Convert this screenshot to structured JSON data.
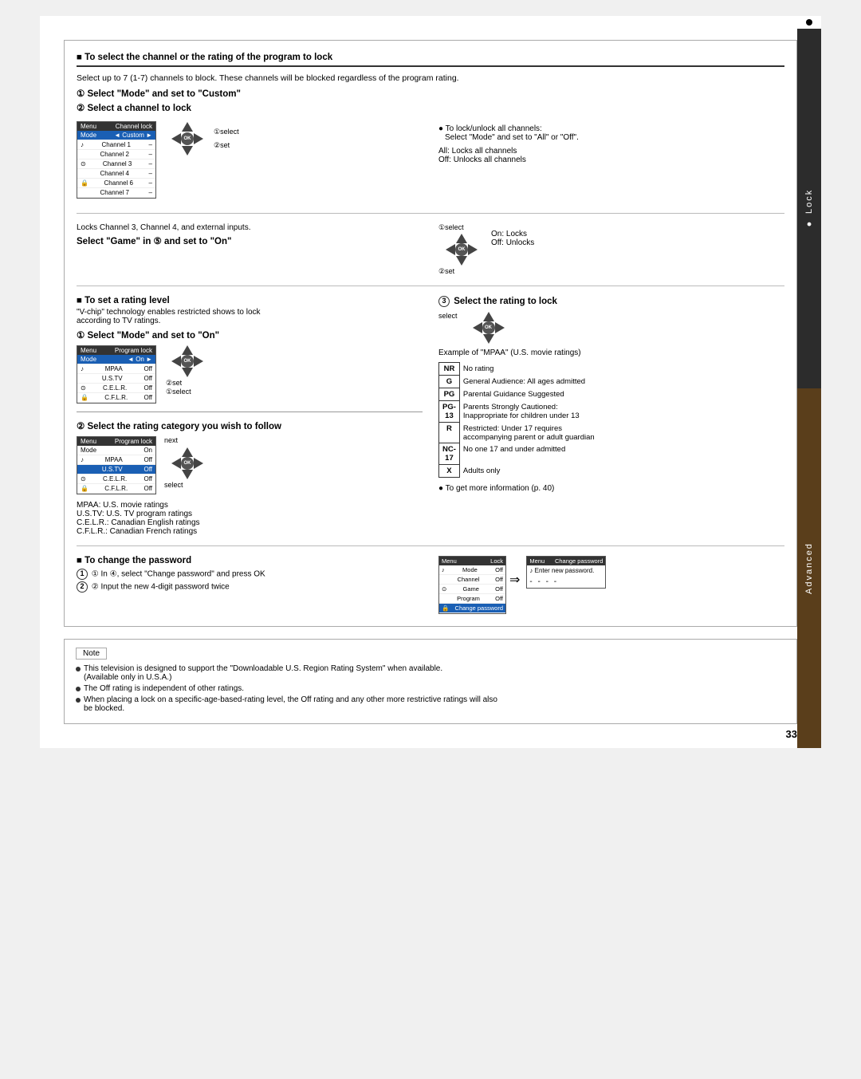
{
  "page": {
    "number": "33",
    "header": {
      "section_marker": "■",
      "title": "To select the channel or the rating of the program to lock"
    },
    "intro": "Select up to 7 (1-7) channels to block. These channels will be blocked regardless of the program rating.",
    "step1_title": "① Select \"Mode\" and set to \"Custom\"",
    "step2_title": "② Select a channel to lock",
    "right_info_1": "● To lock/unlock all channels:",
    "right_info_2": "Select \"Mode\" and set to \"All\" or \"Off\".",
    "right_info_3": "All:  Locks all channels",
    "right_info_4": "Off:  Unlocks all channels",
    "channel_lock_menu": {
      "title": "Channel lock",
      "col1": "Mode",
      "col2": "◄ Custom ►",
      "rows": [
        {
          "icon": "♪",
          "label": "Channel 1",
          "value": "–"
        },
        {
          "icon": "",
          "label": "Channel 2",
          "value": "–"
        },
        {
          "icon": "⊙",
          "label": "Channel 3",
          "value": "–"
        },
        {
          "icon": "",
          "label": "Channel 4",
          "value": "–"
        },
        {
          "icon": "🔒",
          "label": "Channel 6",
          "value": "–"
        },
        {
          "icon": "",
          "label": "Channel 7",
          "value": "–"
        }
      ]
    },
    "select_label_1": "①select",
    "set_label_1": "②set",
    "game_section": {
      "text": "Locks Channel 3, Channel 4, and external inputs.",
      "title": "Select \"Game\" in ⑤ and set to \"On\"",
      "on_locks": "On:  Locks",
      "off_unlocks": "Off:  Unlocks",
      "select_label": "①select",
      "set_label": "②set"
    },
    "rating_section": {
      "marker": "■",
      "title": "To set a rating level",
      "desc1": "\"V-chip\" technology enables restricted shows to lock",
      "desc2": "according to TV ratings.",
      "step1": "① Select \"Mode\" and set to \"On\"",
      "step2": "② Select the rating category you wish to follow",
      "step2_note": "next",
      "step2_select": "select",
      "mpaa_note": "MPAA:   U.S. movie ratings",
      "ustv_note": "U.S.TV:  U.S. TV program ratings",
      "celr_note": "C.E.L.R.: Canadian English ratings",
      "cflr_note": "C.F.L.R.: Canadian French ratings",
      "program_lock_menu": {
        "title": "Program lock",
        "col1": "Mode",
        "col2": "On",
        "rows": [
          {
            "label": "MPAA",
            "value": "Off"
          },
          {
            "label": "U.S.TV",
            "value": "Off"
          },
          {
            "label": "C.E.L.R.",
            "value": "Off"
          },
          {
            "label": "C.F.L.R.",
            "value": "Off"
          }
        ]
      },
      "set_label": "②set",
      "select_label": "①select",
      "program_lock_menu2": {
        "title": "Program lock",
        "col1": "Mode",
        "col2": "On",
        "rows": [
          {
            "label": "MPAA",
            "value": "Off",
            "highlighted": false
          },
          {
            "label": "U.S.TV",
            "value": "Off",
            "highlighted": true
          },
          {
            "label": "C.E.L.R.",
            "value": "Off",
            "highlighted": false
          },
          {
            "label": "C.F.L.R.",
            "value": "Off",
            "highlighted": false
          }
        ]
      }
    },
    "select_rating": {
      "marker": "③",
      "title": "Select the rating to lock",
      "select_label": "select",
      "example": "Example of \"MPAA\" (U.S. movie ratings)",
      "ratings": [
        {
          "code": "NR",
          "desc": "No rating"
        },
        {
          "code": "G",
          "desc": "General Audience: All ages admitted"
        },
        {
          "code": "PG",
          "desc": "Parental Guidance Suggested"
        },
        {
          "code": "PG-\n13",
          "desc": "Parents Strongly Cautioned:\nInappropriate for children under 13"
        },
        {
          "code": "R",
          "desc": "Restricted: Under 17 requires\naccompanying parent or adult guardian"
        },
        {
          "code": "NC-\n17",
          "desc": "No one 17 and under admitted"
        },
        {
          "code": "X",
          "desc": "Adults only"
        }
      ],
      "more_info": "● To get more information (p. 40)"
    },
    "password_section": {
      "marker": "■",
      "title": "To change the password",
      "step1": "① In ④, select \"Change password\" and press OK",
      "step2": "② Input the new 4-digit password twice",
      "lock_menu": {
        "title": "Lock",
        "rows": [
          {
            "label": "Mode",
            "value": "Off"
          },
          {
            "label": "Channel",
            "value": "Off"
          },
          {
            "label": "Game",
            "value": "Off"
          },
          {
            "label": "Program",
            "value": "Off"
          },
          {
            "label": "Change password",
            "highlighted": true
          }
        ]
      },
      "change_pw_menu": {
        "title": "Change password",
        "text1": "Enter new password.",
        "dots": "- - - -"
      }
    },
    "note_section": {
      "title": "Note",
      "items": [
        "This television is designed to support the  \"Downloadable U.S. Region Rating System\" when available.\n(Available only in U.S.A.)",
        "The Off rating is independent of other ratings.",
        "When placing a lock on a specific-age-based-rating level, the Off rating and any other more restrictive ratings will also\nbe blocked."
      ]
    },
    "sidebar": {
      "lock_label": "● Lock",
      "advanced_label": "Advanced"
    }
  }
}
